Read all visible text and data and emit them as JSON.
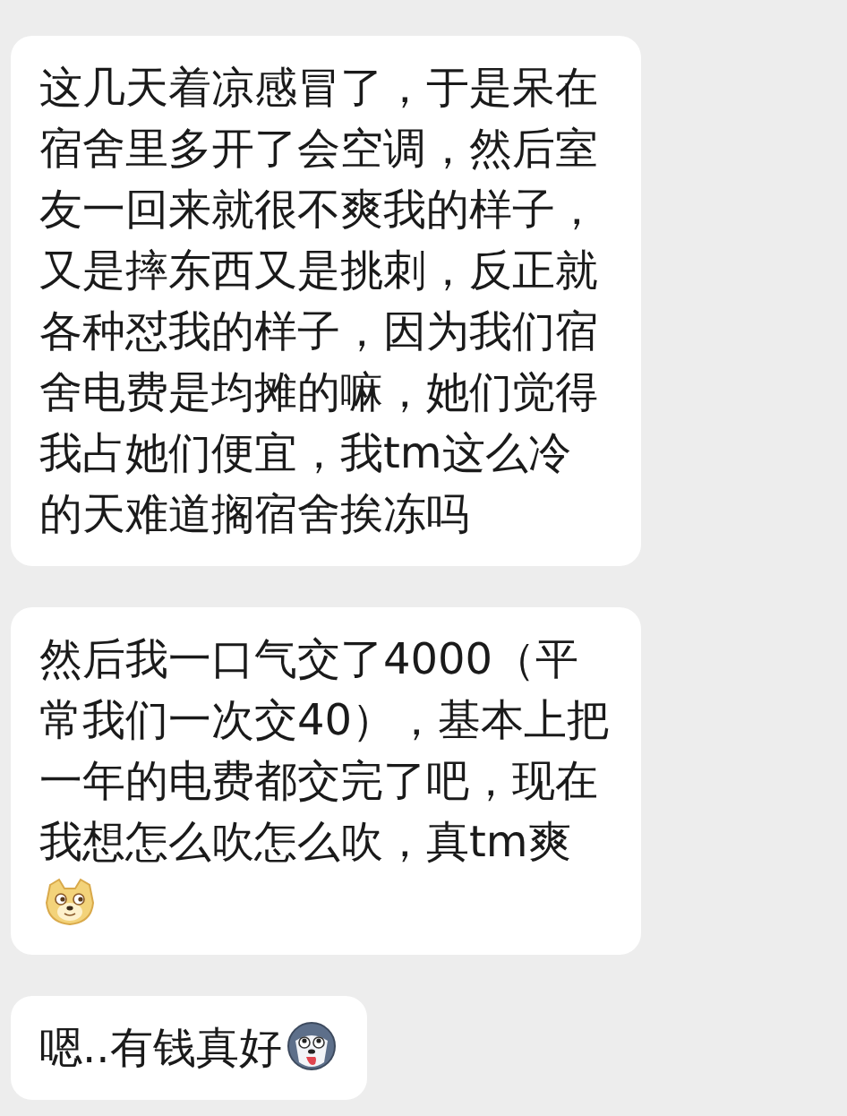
{
  "messages": [
    {
      "text": "这几天着凉感冒了，于是呆在宿舍里多开了会空调，然后室友一回来就很不爽我的样子，又是摔东西又是挑刺，反正就各种怼我的样子，因为我们宿舍电费是均摊的嘛，她们觉得我占她们便宜，我tm这么冷的天难道搁宿舍挨冻吗",
      "kind": "plain"
    },
    {
      "text": "然后我一口气交了4000（平常我们一次交40），基本上把一年的电费都交完了吧，现在我想怎么吹怎么吹，真tm爽",
      "kind": "dog-emoji"
    },
    {
      "text": "嗯..有钱真好",
      "kind": "husky-emoji"
    }
  ]
}
